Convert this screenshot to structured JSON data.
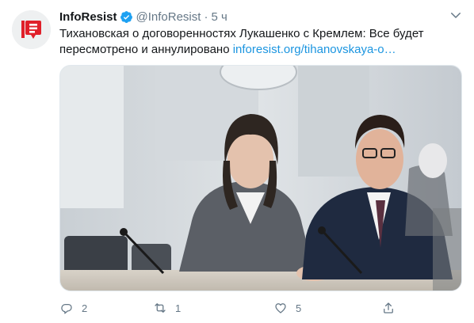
{
  "tweet": {
    "author_name": "InfoResist",
    "author_handle": "@InfoResist",
    "separator": "·",
    "time": "5 ч",
    "text": "Тихановская о договоренностях Лукашенко с Кремлем: Все будет пересмотрено и аннулировано",
    "link_text": "inforesist.org/tihanovskaya-o…",
    "verified": true
  },
  "actions": {
    "reply_count": "2",
    "retweet_count": "1",
    "like_count": "5"
  },
  "icons": {
    "avatar": "inforesist-logo",
    "verified": "verified-badge-icon",
    "caret": "chevron-down-icon",
    "reply": "reply-icon",
    "retweet": "retweet-icon",
    "like": "heart-icon",
    "share": "share-icon"
  },
  "colors": {
    "link": "#1b95e0",
    "verified": "#1da1f2",
    "secondary_text": "#657786",
    "logo_red": "#e0202a"
  }
}
